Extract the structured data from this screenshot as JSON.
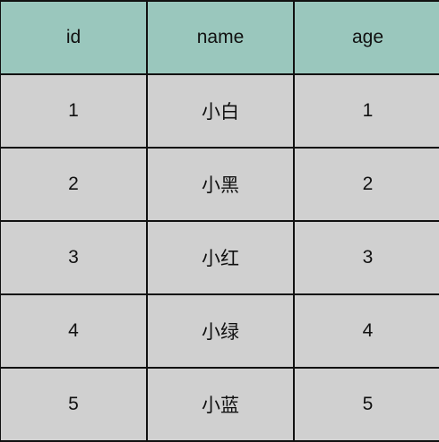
{
  "table": {
    "columns": [
      "id",
      "name",
      "age"
    ],
    "rows": [
      [
        "1",
        "小白",
        "1"
      ],
      [
        "2",
        "小黑",
        "2"
      ],
      [
        "3",
        "小红",
        "3"
      ],
      [
        "4",
        "小绿",
        "4"
      ],
      [
        "5",
        "小蓝",
        "5"
      ]
    ]
  },
  "colors": {
    "header_bg": "#9ac7bd",
    "row_bg": "#d0d0d0",
    "border": "#111111"
  }
}
